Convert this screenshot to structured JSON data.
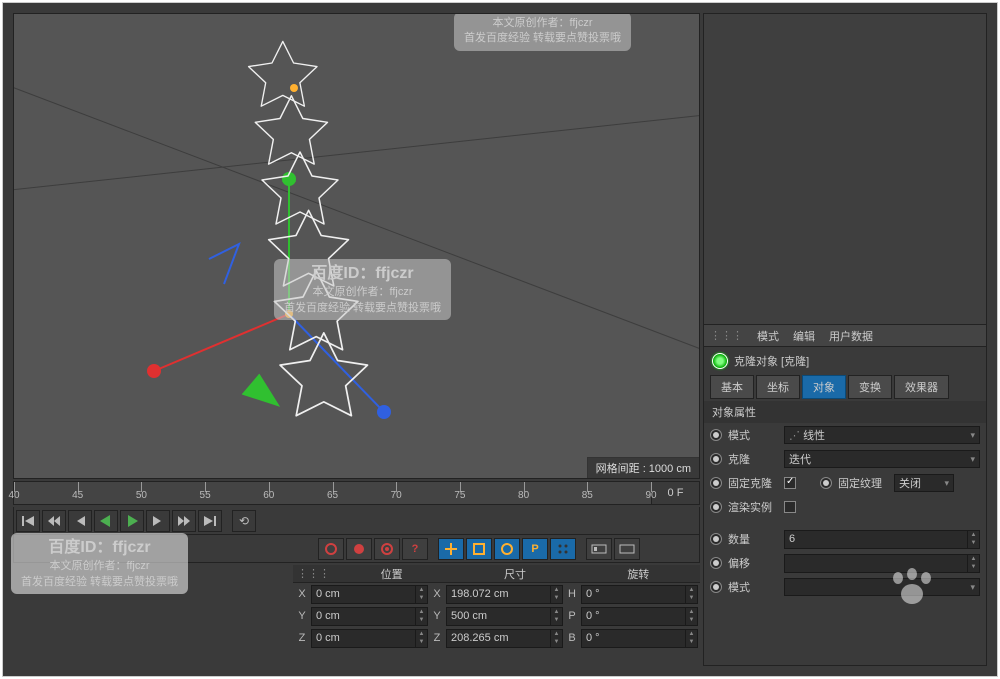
{
  "viewport": {
    "grid_spacing": "网格间距 : 1000 cm"
  },
  "watermarks": {
    "id_line": "百度ID：ffjczr",
    "author": "本文原创作者：ffjczr",
    "source": "首发百度经验 转载要点赞投票哦"
  },
  "timeline": {
    "ticks": [
      40,
      45,
      50,
      55,
      60,
      65,
      70,
      75,
      80,
      85,
      90
    ],
    "temperature": "0 F"
  },
  "coords": {
    "headers": {
      "pos": "位置",
      "size": "尺寸",
      "rot": "旋转"
    },
    "rows": [
      {
        "axis": "X",
        "pos": "0 cm",
        "size": "198.072 cm",
        "rot_axis": "H",
        "rot": "0 °"
      },
      {
        "axis": "Y",
        "pos": "0 cm",
        "size": "500 cm",
        "rot_axis": "P",
        "rot": "0 °"
      },
      {
        "axis": "Z",
        "pos": "0 cm",
        "size": "208.265 cm",
        "rot_axis": "B",
        "rot": "0 °"
      }
    ]
  },
  "attributes": {
    "menu": {
      "mode": "模式",
      "edit": "编辑",
      "userdata": "用户数据"
    },
    "object_title": "克隆对象 [克隆]",
    "tabs": {
      "basic": "基本",
      "coord": "坐标",
      "object": "对象",
      "transform": "变换",
      "effector": "效果器"
    },
    "section": "对象属性",
    "props": {
      "mode_label": "模式",
      "mode_value": "线性",
      "clone_label": "克隆",
      "clone_value": "迭代",
      "fixclone_label": "固定克隆",
      "fixtex_label": "固定纹理",
      "fixtex_value": "关闭",
      "render_label": "渲染实例",
      "count_label": "数量",
      "count_value": "6",
      "offset_label": "偏移",
      "pmode_label": "模式",
      "pmode_value": ""
    }
  }
}
